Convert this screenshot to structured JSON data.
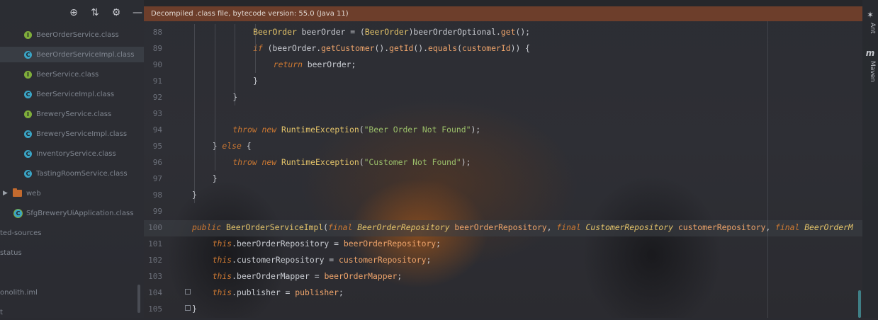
{
  "editor": {
    "banner": "Decompiled .class file, bytecode version: 55.0 (Java 11)",
    "current_line": 100,
    "lines": [
      {
        "n": "88",
        "indent": 3,
        "tokens": [
          [
            "t",
            "BeerOrder"
          ],
          [
            "u",
            " beerOrder = ("
          ],
          [
            "t",
            "BeerOrder"
          ],
          [
            "u",
            ")beerOrderOptional."
          ],
          [
            "m",
            "get"
          ],
          [
            "u",
            "();"
          ]
        ]
      },
      {
        "n": "89",
        "indent": 3,
        "tokens": [
          [
            "ki",
            "if"
          ],
          [
            "u",
            " (beerOrder."
          ],
          [
            "m",
            "getCustomer"
          ],
          [
            "u",
            "()."
          ],
          [
            "m",
            "getId"
          ],
          [
            "u",
            "()."
          ],
          [
            "m",
            "equals"
          ],
          [
            "u",
            "("
          ],
          [
            "p",
            "customerId"
          ],
          [
            "u",
            ")) {"
          ]
        ]
      },
      {
        "n": "90",
        "indent": 4,
        "tokens": [
          [
            "ki",
            "return"
          ],
          [
            "u",
            " beerOrder;"
          ]
        ]
      },
      {
        "n": "91",
        "indent": 3,
        "tokens": [
          [
            "u",
            "}"
          ]
        ]
      },
      {
        "n": "92",
        "indent": 2,
        "tokens": [
          [
            "u",
            "}"
          ]
        ]
      },
      {
        "n": "93",
        "indent": 0,
        "tokens": []
      },
      {
        "n": "94",
        "indent": 2,
        "tokens": [
          [
            "ki",
            "throw"
          ],
          [
            "u",
            " "
          ],
          [
            "ki",
            "new"
          ],
          [
            "u",
            " "
          ],
          [
            "t",
            "RuntimeException"
          ],
          [
            "u",
            "("
          ],
          [
            "s",
            "\"Beer Order Not Found\""
          ],
          [
            "u",
            ");"
          ]
        ]
      },
      {
        "n": "95",
        "indent": 1,
        "tokens": [
          [
            "u",
            "} "
          ],
          [
            "ki",
            "else"
          ],
          [
            "u",
            " {"
          ]
        ]
      },
      {
        "n": "96",
        "indent": 2,
        "tokens": [
          [
            "ki",
            "throw"
          ],
          [
            "u",
            " "
          ],
          [
            "ki",
            "new"
          ],
          [
            "u",
            " "
          ],
          [
            "t",
            "RuntimeException"
          ],
          [
            "u",
            "("
          ],
          [
            "s",
            "\"Customer Not Found\""
          ],
          [
            "u",
            ");"
          ]
        ]
      },
      {
        "n": "97",
        "indent": 1,
        "tokens": [
          [
            "u",
            "}"
          ]
        ]
      },
      {
        "n": "98",
        "indent": 0,
        "tokens": [
          [
            "u",
            "}"
          ]
        ]
      },
      {
        "n": "99",
        "indent": 0,
        "tokens": []
      },
      {
        "n": "100",
        "indent": 0,
        "tokens": [
          [
            "ki",
            "public"
          ],
          [
            "u",
            " "
          ],
          [
            "t",
            "BeerOrderServiceImpl"
          ],
          [
            "u",
            "("
          ],
          [
            "ki",
            "final"
          ],
          [
            "u",
            " "
          ],
          [
            "ti",
            "BeerOrderRepository"
          ],
          [
            "u",
            " "
          ],
          [
            "p",
            "beerOrderRepository"
          ],
          [
            "u",
            ", "
          ],
          [
            "ki",
            "final"
          ],
          [
            "u",
            " "
          ],
          [
            "ti",
            "CustomerRepository"
          ],
          [
            "u",
            " "
          ],
          [
            "p",
            "customerRepository"
          ],
          [
            "u",
            ", "
          ],
          [
            "ki",
            "final"
          ],
          [
            "u",
            " "
          ],
          [
            "ti",
            "BeerOrderM"
          ]
        ]
      },
      {
        "n": "101",
        "indent": 1,
        "tokens": [
          [
            "ki",
            "this"
          ],
          [
            "u",
            ".beerOrderRepository = "
          ],
          [
            "p",
            "beerOrderRepository"
          ],
          [
            "u",
            ";"
          ]
        ]
      },
      {
        "n": "102",
        "indent": 1,
        "tokens": [
          [
            "ki",
            "this"
          ],
          [
            "u",
            ".customerRepository = "
          ],
          [
            "p",
            "customerRepository"
          ],
          [
            "u",
            ";"
          ]
        ]
      },
      {
        "n": "103",
        "indent": 1,
        "tokens": [
          [
            "ki",
            "this"
          ],
          [
            "u",
            ".beerOrderMapper = "
          ],
          [
            "p",
            "beerOrderMapper"
          ],
          [
            "u",
            ";"
          ]
        ]
      },
      {
        "n": "104",
        "indent": 1,
        "tokens": [
          [
            "ki",
            "this"
          ],
          [
            "u",
            ".publisher = "
          ],
          [
            "p",
            "publisher"
          ],
          [
            "u",
            ";"
          ]
        ]
      },
      {
        "n": "105",
        "indent": 0,
        "tokens": [
          [
            "u",
            "}"
          ]
        ]
      }
    ]
  },
  "project": {
    "toolbar": [
      "locate-icon",
      "collapse-icon",
      "gear-icon",
      "hide-icon"
    ],
    "items": [
      {
        "label": "BeerOrderService.class",
        "icon": "interface",
        "selected": false
      },
      {
        "label": "BeerOrderServiceImpl.class",
        "icon": "class",
        "selected": true
      },
      {
        "label": "BeerService.class",
        "icon": "interface",
        "selected": false
      },
      {
        "label": "BeerServiceImpl.class",
        "icon": "class",
        "selected": false
      },
      {
        "label": "BreweryService.class",
        "icon": "interface",
        "selected": false
      },
      {
        "label": "BreweryServiceImpl.class",
        "icon": "class",
        "selected": false
      },
      {
        "label": "InventoryService.class",
        "icon": "class",
        "selected": false
      },
      {
        "label": "TastingRoomService.class",
        "icon": "class",
        "selected": false
      },
      {
        "label": "web",
        "icon": "folder",
        "selected": false
      },
      {
        "label": "SfgBreweryUiApplication.class",
        "icon": "app",
        "selected": false
      },
      {
        "label": "ted-sources",
        "icon": "none",
        "selected": false
      },
      {
        "label": "status",
        "icon": "none",
        "selected": false
      },
      {
        "label": "onolith.iml",
        "icon": "none",
        "selected": false
      },
      {
        "label": "t",
        "icon": "none",
        "selected": false
      }
    ]
  },
  "rightbar": {
    "ant_label": "Ant",
    "maven_label": "Maven"
  },
  "colors": {
    "banner": "#96482680",
    "keyword": "#cc7832",
    "type": "#e4c46a",
    "string": "#9bbf6a",
    "param": "#eda36a"
  }
}
